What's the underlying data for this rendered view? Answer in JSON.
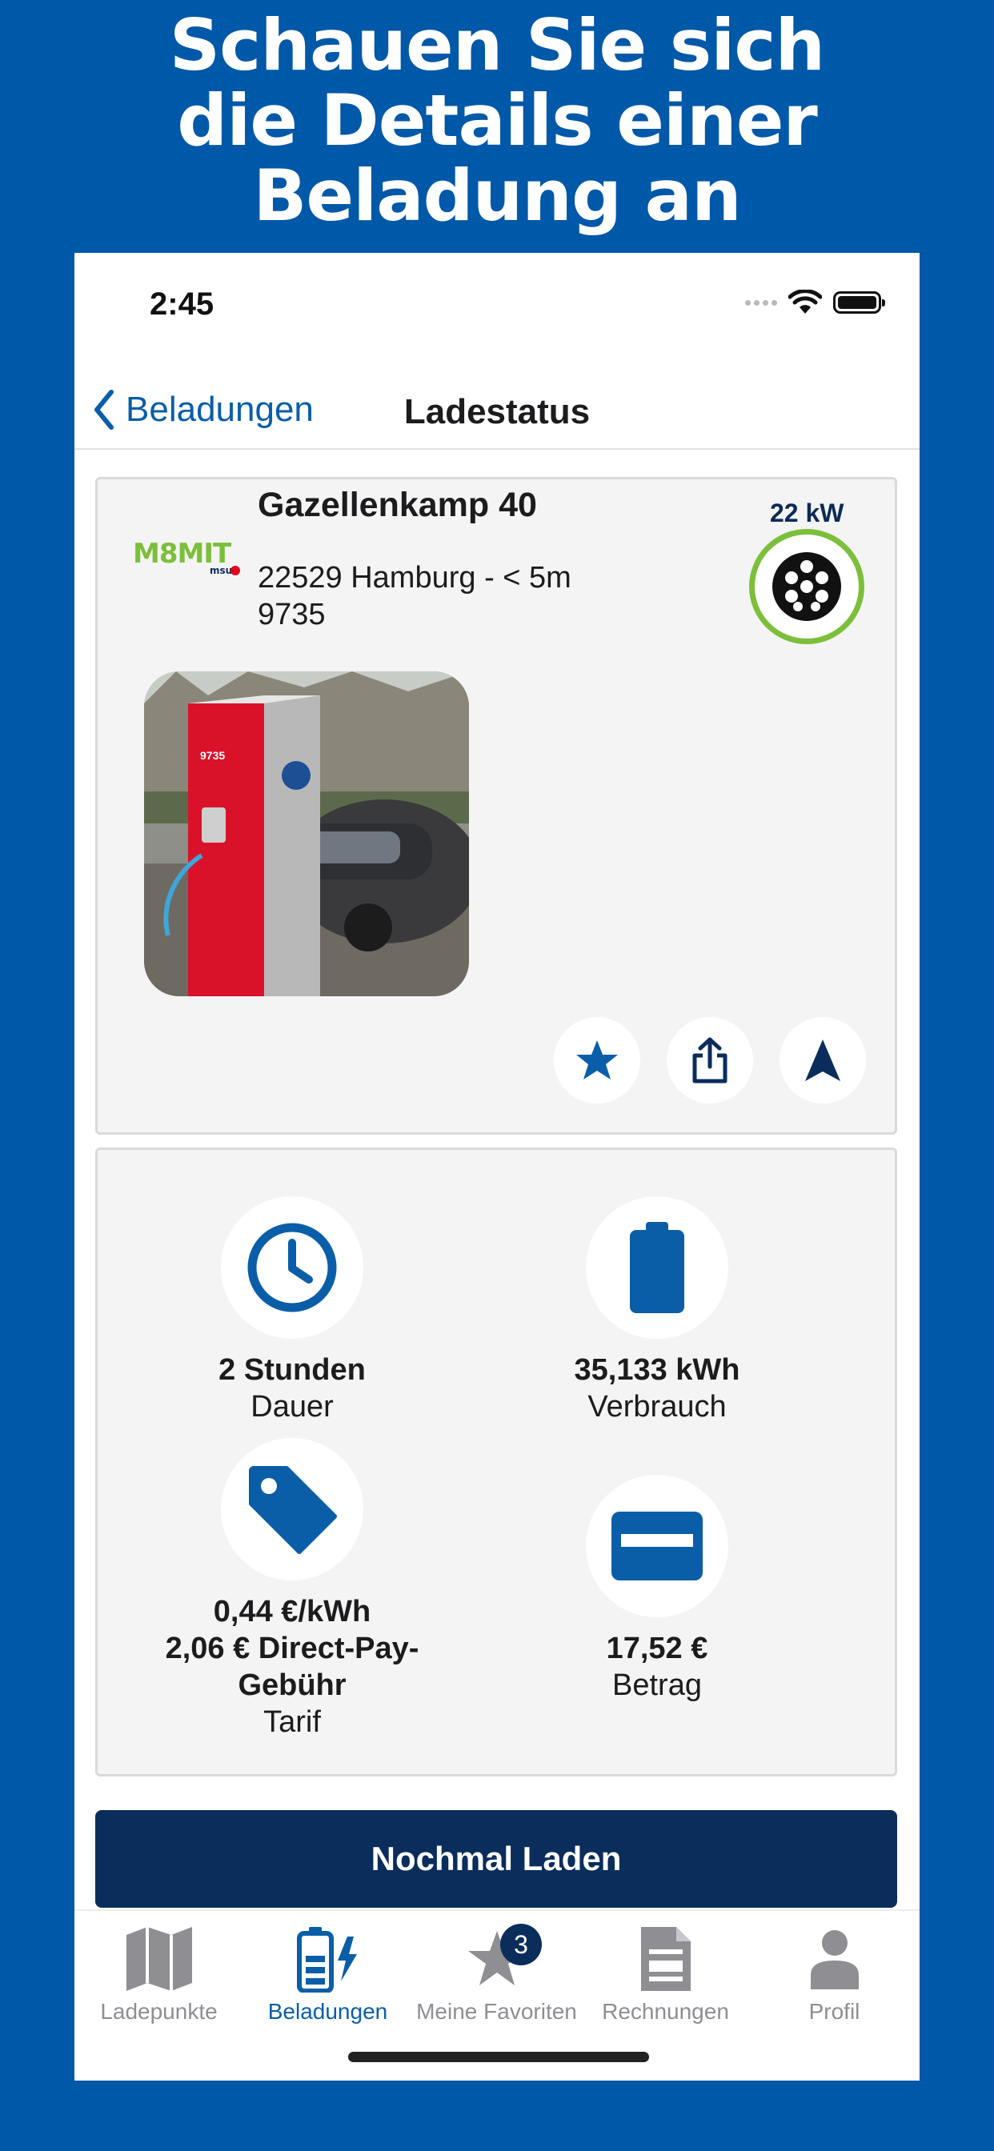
{
  "headline": [
    "Schauen Sie sich",
    "die Details einer",
    "Beladung an"
  ],
  "status_bar": {
    "time": "2:45"
  },
  "navbar": {
    "back_label": "Beladungen",
    "title": "Ladestatus"
  },
  "station": {
    "operator_logo_text": "M8MIT",
    "operator_logo_sub": "msu",
    "name": "Gazellenkamp 40",
    "address": "22529 Hamburg - < 5m",
    "station_id": "9735",
    "power": "22 kW",
    "plug_icon": "type2-plug-icon"
  },
  "actions": {
    "favorite_icon": "star-icon",
    "share_icon": "share-icon",
    "navigate_icon": "navigation-arrow-icon"
  },
  "stats": {
    "duration": {
      "value": "2 Stunden",
      "label": "Dauer",
      "icon": "clock-icon"
    },
    "consumption": {
      "value": "35,133 kWh",
      "label": "Verbrauch",
      "icon": "battery-icon"
    },
    "tariff": {
      "value_line1": "0,44 €/kWh",
      "value_line2": "2,06 € Direct-Pay-Gebühr",
      "label": "Tarif",
      "icon": "price-tag-icon"
    },
    "amount": {
      "value": "17,52 €",
      "label": "Betrag",
      "icon": "credit-card-icon"
    }
  },
  "cta": {
    "label": "Nochmal Laden"
  },
  "tabbar": {
    "items": [
      {
        "label": "Ladepunkte",
        "icon": "map-icon"
      },
      {
        "label": "Beladungen",
        "icon": "charging-battery-icon"
      },
      {
        "label": "Meine Favoriten",
        "icon": "star-icon",
        "badge": "3"
      },
      {
        "label": "Rechnungen",
        "icon": "invoice-icon"
      },
      {
        "label": "Profil",
        "icon": "person-icon"
      }
    ],
    "active_index": 1
  },
  "colors": {
    "background": "#0058a8",
    "accent": "#0a5ea8",
    "dark_blue": "#0a2d5b",
    "plug_ring": "#7cbf3a"
  }
}
